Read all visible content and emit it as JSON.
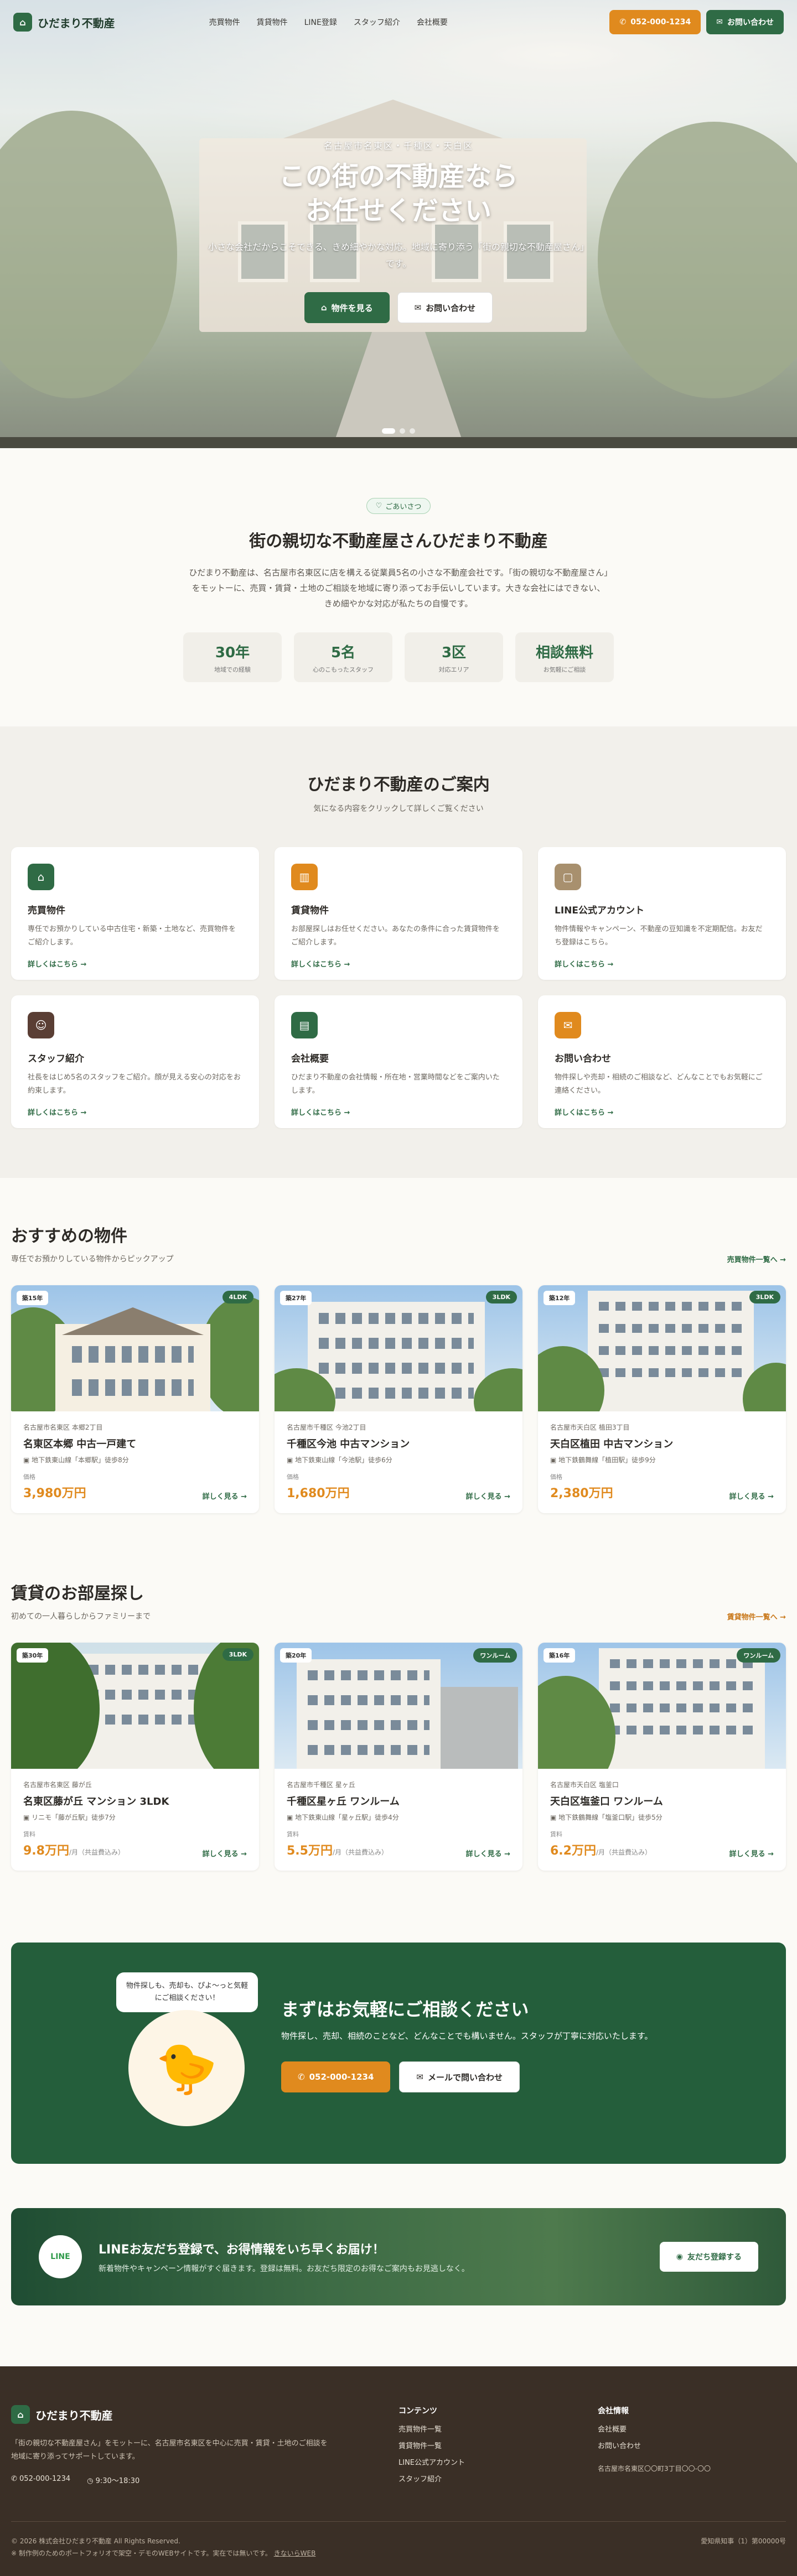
{
  "header": {
    "logo_icon": "home-icon",
    "logo_text": "ひだまり不動産",
    "nav": [
      "売買物件",
      "賃貸物件",
      "LINE登録",
      "スタッフ紹介",
      "会社概要"
    ],
    "phone_label": "052-000-1234",
    "contact_label": "お問い合わせ"
  },
  "hero": {
    "kicker": "名古屋市名東区・千種区・天白区",
    "title_line1": "この街の不動産なら",
    "title_line2": "お任せください",
    "sub": "小さな会社だからこそできる、きめ細やかな対応。地域に寄り添う「街の親切な不動産屋さん」です。",
    "btn_primary": "物件を見る",
    "btn_secondary": "お問い合わせ"
  },
  "about": {
    "pill": "ごあいさつ",
    "title": "街の親切な不動産屋さんひだまり不動産",
    "body": "ひだまり不動産は、名古屋市名東区に店を構える従業員5名の小さな不動産会社です。「街の親切な不動産屋さん」をモットーに、売買・賃貸・土地のご相談を地域に寄り添ってお手伝いしています。大きな会社にはできない、きめ細やかな対応が私たちの自慢です。",
    "stats": [
      {
        "value": "30年",
        "label": "地域での経験"
      },
      {
        "value": "5名",
        "label": "心のこもったスタッフ"
      },
      {
        "value": "3区",
        "label": "対応エリア"
      },
      {
        "value": "相談無料",
        "label": "お気軽にご相談"
      }
    ]
  },
  "guide": {
    "title": "ひだまり不動産のご案内",
    "lead": "気になる内容をクリックして詳しくご覧ください",
    "more": "詳しくはこちら →",
    "cards": [
      {
        "title": "売買物件",
        "desc": "専任でお預かりしている中古住宅・新築・土地など、売買物件をご紹介します。",
        "icon": "home-icon",
        "color": "#2f6b45"
      },
      {
        "title": "賃貸物件",
        "desc": "お部屋探しはお任せください。あなたの条件に合った賃貸物件をご紹介します。",
        "icon": "building-icon",
        "color": "#e08a1e"
      },
      {
        "title": "LINE公式アカウント",
        "desc": "物件情報やキャンペーン、不動産の豆知識を不定期配信。お友だち登録はこちら。",
        "icon": "chat-icon",
        "color": "#a8906e"
      },
      {
        "title": "スタッフ紹介",
        "desc": "社長をはじめ5名のスタッフをご紹介。顔が見える安心の対応をお約束します。",
        "icon": "users-icon",
        "color": "#5a3e34"
      },
      {
        "title": "会社概要",
        "desc": "ひだまり不動産の会社情報・所在地・営業時間などをご案内いたします。",
        "icon": "store-icon",
        "color": "#2f6b45"
      },
      {
        "title": "お問い合わせ",
        "desc": "物件探しや売却・相続のご相談など、どんなことでもお気軽にご連絡ください。",
        "icon": "mail-icon",
        "color": "#e08a1e"
      }
    ]
  },
  "sale": {
    "title": "おすすめの物件",
    "sub": "専任でお預かりしている物件からピックアップ",
    "link": "売買物件一覧へ →",
    "items": [
      {
        "age": "築15年",
        "layout": "4LDK",
        "loc": "名古屋市名東区 本郷2丁目",
        "name": "名東区本郷 中古一戸建て",
        "station": "地下鉄東山線「本郷駅」徒歩8分",
        "price_label": "価格",
        "price": "3,980万円",
        "more": "詳しく見る →"
      },
      {
        "age": "築27年",
        "layout": "3LDK",
        "loc": "名古屋市千種区 今池2丁目",
        "name": "千種区今池 中古マンション",
        "station": "地下鉄東山線「今池駅」徒歩6分",
        "price_label": "価格",
        "price": "1,680万円",
        "more": "詳しく見る →"
      },
      {
        "age": "築12年",
        "layout": "3LDK",
        "loc": "名古屋市天白区 植田3丁目",
        "name": "天白区植田 中古マンション",
        "station": "地下鉄鶴舞線「植田駅」徒歩9分",
        "price_label": "価格",
        "price": "2,380万円",
        "more": "詳しく見る →"
      }
    ]
  },
  "rent": {
    "title": "賃貸のお部屋探し",
    "sub": "初めての一人暮らしからファミリーまで",
    "link": "賃貸物件一覧へ →",
    "items": [
      {
        "age": "築30年",
        "layout": "3LDK",
        "loc": "名古屋市名東区 藤が丘",
        "name": "名東区藤が丘 マンション 3LDK",
        "station": "リニモ「藤が丘駅」徒歩7分",
        "price_label": "賃料",
        "price": "9.8万円",
        "unit": "/月（共益費込み）",
        "more": "詳しく見る →"
      },
      {
        "age": "築20年",
        "layout": "ワンルーム",
        "loc": "名古屋市千種区 星ヶ丘",
        "name": "千種区星ヶ丘 ワンルーム",
        "station": "地下鉄東山線「星ヶ丘駅」徒歩4分",
        "price_label": "賃料",
        "price": "5.5万円",
        "unit": "/月（共益費込み）",
        "more": "詳しく見る →"
      },
      {
        "age": "築16年",
        "layout": "ワンルーム",
        "loc": "名古屋市天白区 塩釜口",
        "name": "天白区塩釜口 ワンルーム",
        "station": "地下鉄鶴舞線「塩釜口駅」徒歩5分",
        "price_label": "賃料",
        "price": "6.2万円",
        "unit": "/月（共益費込み）",
        "more": "詳しく見る →"
      }
    ]
  },
  "contact": {
    "bubble": "物件探しも、売却も、ぴよ〜っと気軽にご相談ください！",
    "title": "まずはお気軽にご相談ください",
    "body": "物件探し、売却、相続のことなど、どんなことでも構いません。スタッフが丁寧に対応いたします。",
    "phone": "052-000-1234",
    "mail": "メールで問い合わせ"
  },
  "line": {
    "badge": "LINE",
    "title": "LINEお友だち登録で、お得情報をいち早くお届け！",
    "body": "新着物件やキャンペーン情報がすぐ届きます。登録は無料。お友だち限定のお得なご案内もお見逃しなく。",
    "button": "友だち登録する"
  },
  "footer": {
    "logo": "ひだまり不動産",
    "desc": "「街の親切な不動産屋さん」をモットーに、名古屋市名東区を中心に売買・賃貸・土地のご相談を地域に寄り添ってサポートしています。",
    "phone": "052-000-1234",
    "hours": "9:30〜18:30",
    "col2_title": "コンテンツ",
    "col2_links": [
      "売買物件一覧",
      "賃貸物件一覧",
      "LINE公式アカウント",
      "スタッフ紹介"
    ],
    "col3_title": "会社情報",
    "col3_links": [
      "会社概要",
      "お問い合わせ"
    ],
    "address": "名古屋市名東区〇〇町3丁目〇〇-〇〇",
    "copyright": "© 2026 株式会社ひだまり不動産 All Rights Reserved.",
    "note": "※ 制作例のためのポートフォリオで架空・デモのWEBサイトです。実在では無いです。",
    "note_link": "きないらWEB",
    "license": "愛知県知事（1）第00000号"
  }
}
